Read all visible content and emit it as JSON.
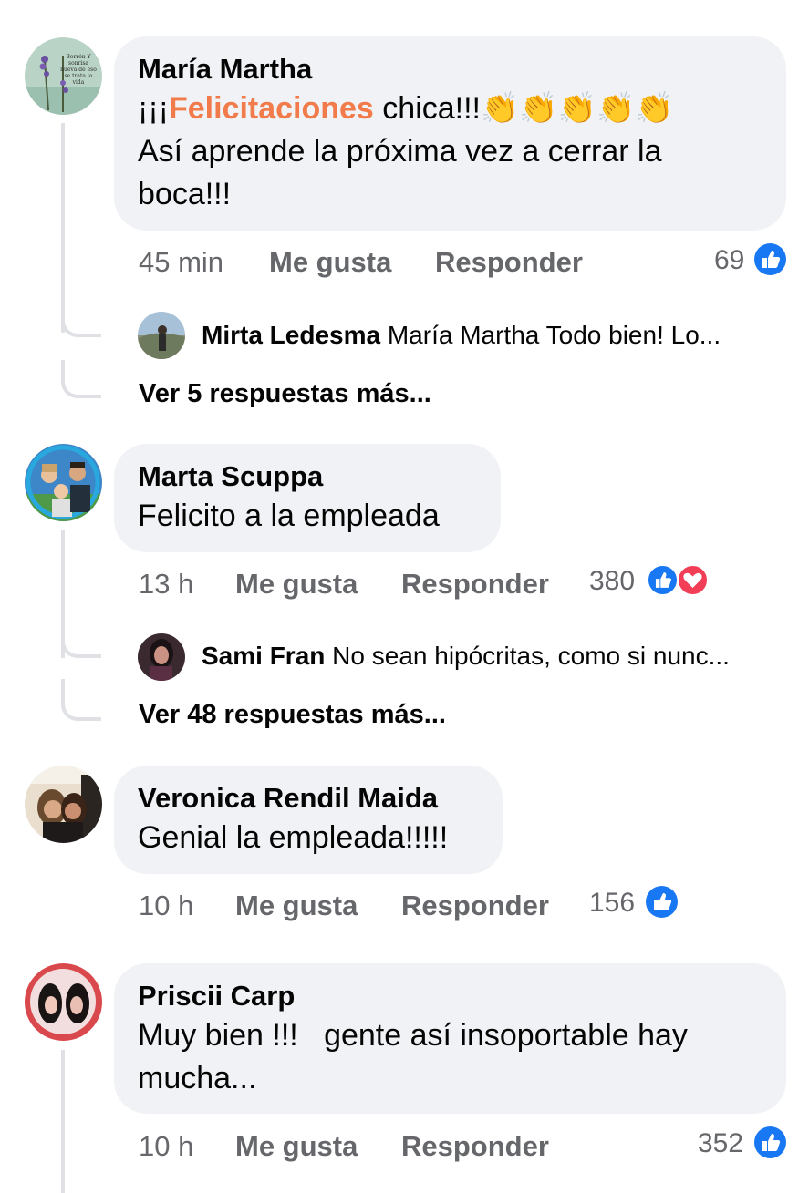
{
  "comments": [
    {
      "author": "María Martha",
      "text_prefix": "¡¡¡",
      "text_highlight": "Felicitaciones",
      "text_suffix": " chica!!!👏👏👏👏👏",
      "text_line2": "Así aprende la próxima vez a cerrar la boca!!!",
      "avatar_caption": "Borrón Y sonrisa nueva de eso se trata la vida",
      "time": "45 min",
      "like_label": "Me gusta",
      "reply_label": "Responder",
      "reaction_count": "69",
      "reactions": [
        "like-icon"
      ],
      "reply_preview": {
        "author": "Mirta Ledesma",
        "text": "María Martha Todo bien! Lo..."
      },
      "more_replies": "Ver 5 respuestas más..."
    },
    {
      "author": "Marta Scuppa",
      "text": "Felicito a la empleada",
      "time": "13 h",
      "like_label": "Me gusta",
      "reply_label": "Responder",
      "reaction_count": "380",
      "reactions": [
        "like-icon",
        "love-icon"
      ],
      "reply_preview": {
        "author": "Sami Fran",
        "text": "No sean hipócritas, como si nunc..."
      },
      "more_replies": "Ver 48 respuestas más..."
    },
    {
      "author": "Veronica Rendil Maida",
      "text": "Genial la empleada!!!!!",
      "time": "10 h",
      "like_label": "Me gusta",
      "reply_label": "Responder",
      "reaction_count": "156",
      "reactions": [
        "like-icon"
      ]
    },
    {
      "author": "Priscii Carp",
      "text": "Muy bien !!!   gente así insoportable hay mucha...",
      "time": "10 h",
      "like_label": "Me gusta",
      "reply_label": "Responder",
      "reaction_count": "352",
      "reactions": [
        "like-icon"
      ]
    }
  ],
  "colors": {
    "bubble": "#f0f2f5",
    "highlight": "#f27b4b",
    "meta": "#65676b",
    "like_blue": "#1877f2",
    "love_red": "#f33e58"
  }
}
